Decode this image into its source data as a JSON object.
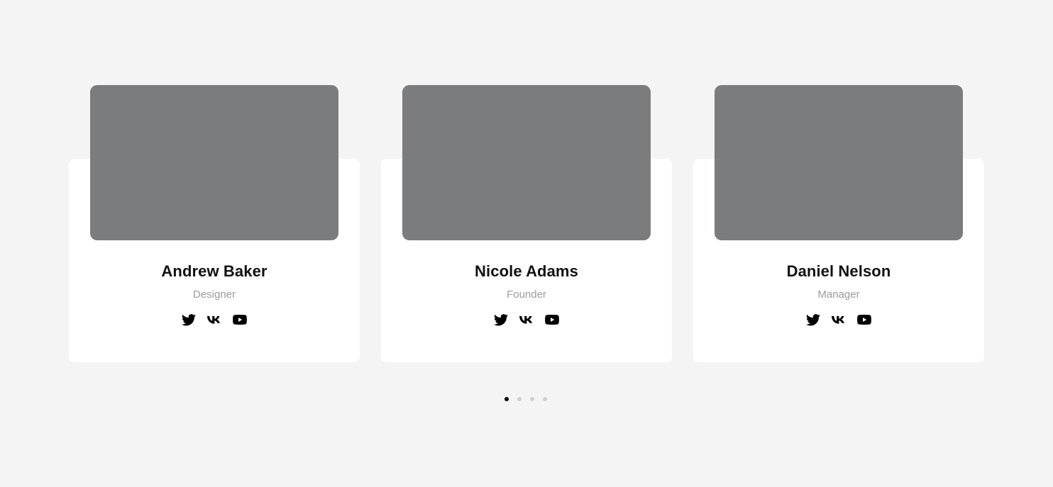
{
  "team": [
    {
      "name": "Andrew Baker",
      "role": "Designer",
      "socials": [
        "twitter-icon",
        "vk-icon",
        "youtube-icon"
      ]
    },
    {
      "name": "Nicole Adams",
      "role": "Founder",
      "socials": [
        "twitter-icon",
        "vk-icon",
        "youtube-icon"
      ]
    },
    {
      "name": "Daniel Nelson",
      "role": "Manager",
      "socials": [
        "twitter-icon",
        "vk-icon",
        "youtube-icon"
      ]
    }
  ],
  "pagination": {
    "total": 4,
    "active_index": 0
  },
  "colors": {
    "background": "#f4f4f4",
    "card": "#ffffff",
    "photo_placeholder": "#7b7c7d",
    "name": "#111111",
    "role": "#9b9b9b",
    "dot_active": "#000000",
    "dot_inactive": "#cfcfcf"
  }
}
